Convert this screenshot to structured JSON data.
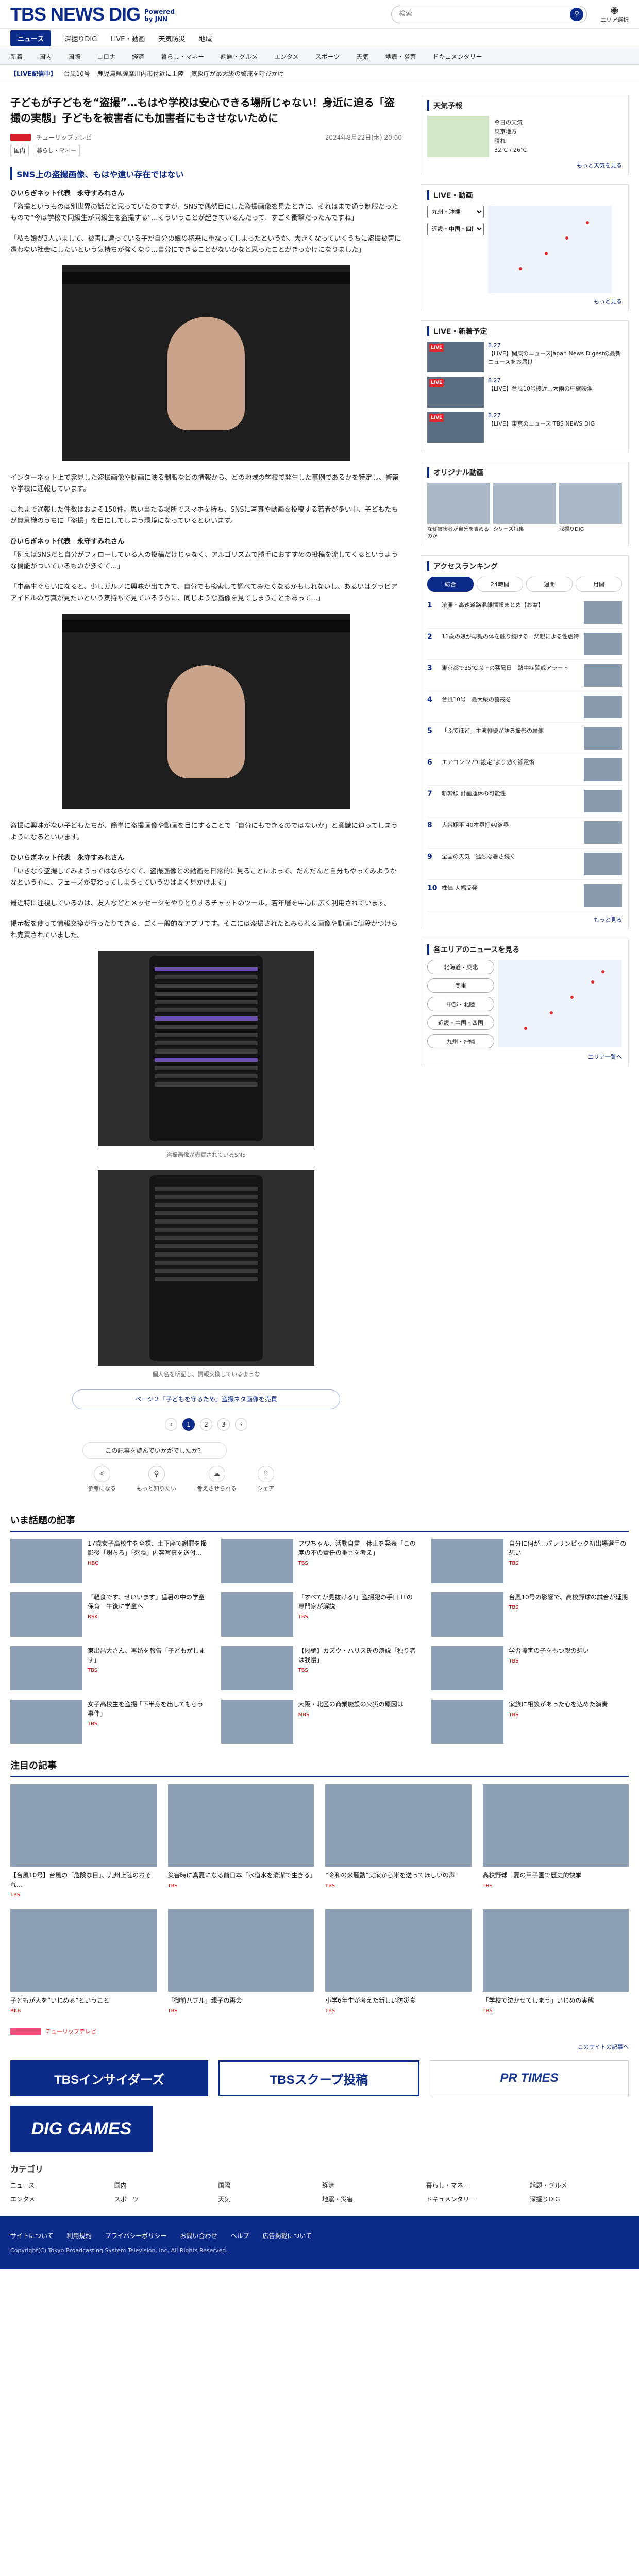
{
  "header": {
    "logo_main": "TBS NEWS DIG",
    "logo_powered": "Powered",
    "logo_by": "by JNN",
    "search_placeholder": "検索",
    "area_label": "エリア選択"
  },
  "nav_primary": [
    {
      "label": "ニュース",
      "active": true
    },
    {
      "label": "深掘りDIG",
      "badge": ""
    },
    {
      "label": "LIVE・動画"
    },
    {
      "label": "天気防災"
    },
    {
      "label": "地域"
    }
  ],
  "nav_secondary": [
    "新着",
    "国内",
    "国際",
    "コロナ",
    "経済",
    "暮らし・マネー",
    "話題・グルメ",
    "エンタメ",
    "スポーツ",
    "天気",
    "地震・災害",
    "ドキュメンタリー"
  ],
  "ticker": {
    "tag": "【LIVE配信中】",
    "items": [
      "台風10号",
      "鹿児島県薩摩川内市付近に上陸",
      "気象庁が最大級の警戒を呼びかけ"
    ]
  },
  "article": {
    "title": "子どもが子どもを“盗撮”…もはや学校は安心できる場所じゃない！身近に迫る「盗撮の実態」子どもを被害者にも加害者にもさせないために",
    "source": "チューリップテレビ",
    "datetime": "2024年8月22日(木) 20:00",
    "tags": [
      "国内",
      "暮らし・マネー"
    ],
    "subheading": "SNS上の盗撮画像、もはや遠い存在ではない",
    "speaker1": "ひいらぎネット代表　永守すみれさん",
    "quote1": "「盗撮というものは別世界の話だと思っていたのですが、SNSで偶然目にした盗撮画像を見たときに、それはまで通う制服だったもので“今は学校で同級生が同級生を盗撮する”…そういうことが起きているんだって、すごく衝撃だったんですね」",
    "quote2": "「私も娘が3人いまして、被害に遭っている子が自分の娘の将来に重なってしまったというか、大きくなっていくうちに盗撮被害に遭わない社会にしたいという気持ちが強くなり…自分にできることがないかなと思ったことがきっかけになりました」",
    "caption1": "",
    "para1": "インターネット上で発見した盗撮画像や動画に映る制服などの情報から、どの地域の学校で発生した事例であるかを特定し、警察や学校に通報しています。",
    "para2": "これまで通報した件数はおよそ150件。思い当たる場所でスマホを持ち、SNSに写真や動画を投稿する若者が多い中、子どもたちが無意識のうちに「盗撮」を目にしてしまう環境になっているといいます。",
    "speaker2": "ひいらぎネット代表　永守すみれさん",
    "quote3": "「例えばSNSだと自分がフォローしている人の投稿だけじゃなく、アルゴリズムで勝手におすすめの投稿を流してくるというような機能がついているものが多くて…」",
    "quote4": "「中高生ぐらいになると、少しガルノに興味が出てきて、自分でも検索して調べてみたくなるかもしれないし、あるいはグラビアアイドルの写真が見たいという気持ちで見ているうちに、同じような画像を見てしまうこともあって…」",
    "para3": "盗撮に興味がない子どもたちが、簡単に盗撮画像や動画を目にすることで「自分にもできるのではないか」と意識に迫ってしまうようになるといいます。",
    "speaker3": "ひいらぎネット代表　永守すみれさん",
    "quote5": "「いきなり盗撮してみようってはならなくて、盗撮画像との動画を日常的に見ることによって、だんだんと自分もやってみようかなという心に、フェーズが変わってしまうっていうのはよく見かけます」",
    "para4": "最近特に注視しているのは、友人などとメッセージをやりとりするチャットのツール。若年層を中心に広く利用されています。",
    "para5": "掲示板を使って情報交換が行ったりできる、ごく一般的なアプリです。そこには盗撮されたとみられる画像や動画に値段がつけられ売買されていました。",
    "caption2": "盗撮画像が売買されているSNS",
    "caption3": "個人名を明記し、情報交換しているような",
    "related_link": "ページ２「子どもを守るため」盗撮ネタ画像を売買",
    "pages": [
      "1",
      "2",
      "3"
    ],
    "reaction_label": "この記事を読んでいかがでしたか？",
    "reactions": [
      "参考になる",
      "もっと知りたい",
      "考えさせられる",
      "シェア"
    ]
  },
  "sidebar": {
    "weather_title": "天気予報",
    "weather_info": [
      "今日の天気",
      "東京地方",
      "晴れ",
      "32℃ / 26℃"
    ],
    "weather_more": "もっと天気を見る",
    "live_title": "LIVE・動画",
    "live_select": "九州・沖縄",
    "live_select2": "近畿・中国・四国",
    "live_more": "もっと見る",
    "newvideo_title": "LIVE・新着予定",
    "live_items": [
      {
        "tag": "LIVE",
        "date": "8.27",
        "text": "【LIVE】関東のニュースJapan News Digestの最新ニュースをお届け"
      },
      {
        "tag": "LIVE",
        "date": "8.27",
        "text": "【LIVE】台風10号接近…大雨の中継映像"
      },
      {
        "tag": "LIVE",
        "date": "8.27",
        "text": "【LIVE】東京のニュース TBS NEWS DIG"
      }
    ],
    "original_title": "オリジナル動画",
    "originals": [
      "なぜ被害者が自分を責めるのか",
      "シリーズ特集",
      "深掘りDIG"
    ],
    "ranking_title": "アクセスランキング",
    "ranking_tabs": [
      "総合",
      "24時間",
      "週間",
      "月間"
    ],
    "ranking": [
      "渋滞・高速道路混雑情報まとめ【お盆】",
      "11歳の娘が母親の体を触り続ける…父親による性虐待",
      "東京都で35℃以上の猛暑日　熱中症警戒アラート",
      "台風10号　最大級の警戒を",
      "「ふてほど」主演俳優が語る撮影の裏側",
      "エアコン“27℃設定”より効く節電術",
      "新幹線 計画運休の可能性",
      "大谷翔平 40本塁打40盗塁",
      "全国の天気　猛烈な暑さ続く",
      "株価 大幅反発"
    ],
    "ranking_more": "もっと見る",
    "area_title": "各エリアのニュースを見る",
    "areas": [
      "北海道・東北",
      "関東",
      "中部・北陸",
      "近畿・中国・四国",
      "九州・沖縄"
    ],
    "area_more": "エリア一覧へ"
  },
  "hot": {
    "title": "いま話題の記事",
    "items": [
      {
        "text": "17歳女子高校生を全裸、土下座で謝罪を撮影後「謝ちろ」「死ね」内容写真を送付…",
        "src": "HBC"
      },
      {
        "text": "フワちゃん、活動自粛　休止を発表「この度の不の責任の重さを考え」",
        "src": "TBS"
      },
      {
        "text": "自分に何が…パラリンピック初出場選手の想い",
        "src": "TBS"
      },
      {
        "text": "「軽食です、せいいます」猛暑の中の学童保育　午後に学童へ",
        "src": "RSK"
      },
      {
        "text": "「すべてが見抜ける!」盗撮犯の手口 ITの専門家が解説",
        "src": "TBS"
      },
      {
        "text": "台風10号の影響で、高校野球の試合が延期",
        "src": "TBS"
      },
      {
        "text": "東出昌大さん、再婚を報告「子どもがします」",
        "src": "TBS"
      },
      {
        "text": "【悶絶】カズウ・ハリス氏の演説「独り者は我慢」",
        "src": "TBS"
      },
      {
        "text": "学習障害の子をもつ親の想い",
        "src": "TBS"
      },
      {
        "text": "女子高校生を盗撮 ｢下半身を出してもらう事件｣",
        "src": "TBS"
      },
      {
        "text": "大阪・北区の商業施設の火災の原因は",
        "src": "MBS"
      },
      {
        "text": "家族に相談があった心を込めた演奏",
        "src": "TBS"
      }
    ]
  },
  "featured": {
    "title": "注目の記事",
    "items": [
      {
        "text": "【台風10号】台風の「危険な目」、九州上陸のおそれ…",
        "src": "TBS"
      },
      {
        "text": "災害時に真夏になる前日本「水道水を清潔で生きる」",
        "src": "TBS"
      },
      {
        "text": "“令和の米騒動”実家から米を送ってほしいの声",
        "src": "TBS"
      },
      {
        "text": "高校野球　夏の甲子園で歴史的快挙",
        "src": "TBS"
      },
      {
        "text": "子どもが人を“いじめる”ということ",
        "src": "RKB"
      },
      {
        "text": "「御前八ブル」親子の再会",
        "src": "TBS"
      },
      {
        "text": "小学6年生が考えた新しい防災食",
        "src": "TBS"
      },
      {
        "text": "「学校で泣かせてしまう」いじめの実態",
        "src": "TBS"
      }
    ],
    "sponsor_label": "チューリップテレビ",
    "more_label": "このサイトの記事へ"
  },
  "banners": [
    "TBSインサイダーズ",
    "TBSスクープ投稿",
    "PR TIMES"
  ],
  "dig_games": "DIG GAMES",
  "category": {
    "title": "カテゴリ",
    "items": [
      "ニュース",
      "国内",
      "国際",
      "経済",
      "暮らし・マネー",
      "話題・グルメ",
      "エンタメ",
      "スポーツ",
      "天気",
      "地震・災害",
      "ドキュメンタリー",
      "深掘りDIG"
    ]
  },
  "footer": {
    "links": [
      "サイトについて",
      "利用規約",
      "プライバシーポリシー",
      "お問い合わせ",
      "ヘルプ",
      "広告掲載について"
    ],
    "copyright": "Copyright(C) Tokyo Broadcasting System Television, Inc. All Rights Reserved."
  }
}
